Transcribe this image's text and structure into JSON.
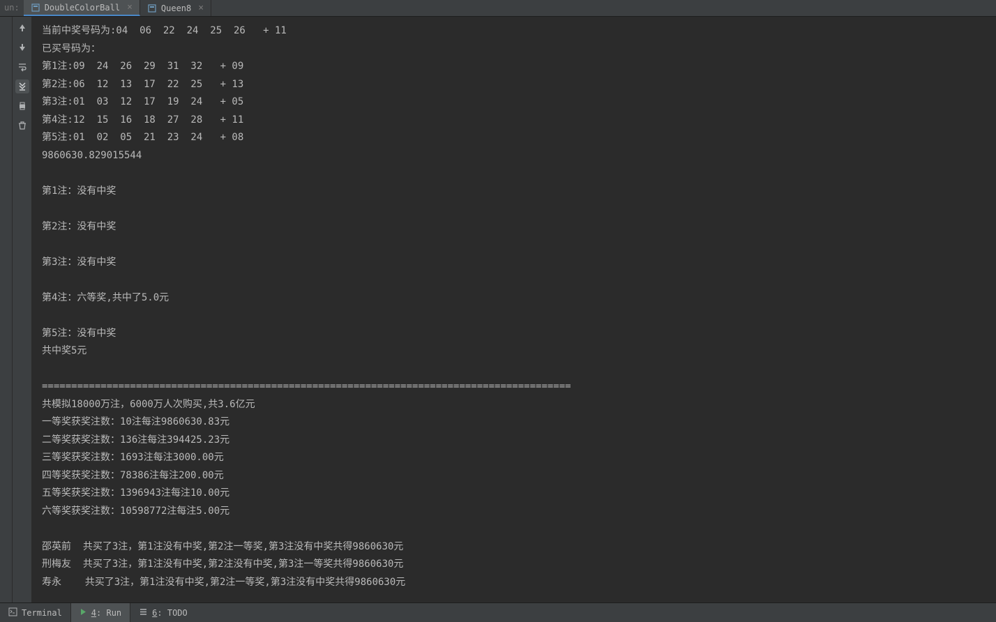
{
  "header": {
    "runLabel": "un:"
  },
  "tabs": [
    {
      "label": "DoubleColorBall",
      "active": true
    },
    {
      "label": "Queen8",
      "active": false
    }
  ],
  "console": {
    "lines": [
      "当前中奖号码为:04  06  22  24  25  26   + 11",
      "已买号码为：",
      "第1注:09  24  26  29  31  32   + 09",
      "第2注:06  12  13  17  22  25   + 13",
      "第3注:01  03  12  17  19  24   + 05",
      "第4注:12  15  16  18  27  28   + 11",
      "第5注:01  02  05  21  23  24   + 08",
      "9860630.829015544",
      "",
      "第1注：没有中奖",
      "",
      "第2注：没有中奖",
      "",
      "第3注：没有中奖",
      "",
      "第4注：六等奖,共中了5.0元",
      "",
      "第5注：没有中奖",
      "共中奖5元",
      "",
      "==========================================================================================",
      "共模拟18000万注，6000万人次购买,共3.6亿元",
      "一等奖获奖注数：10注每注9860630.83元",
      "二等奖获奖注数：136注每注394425.23元",
      "三等奖获奖注数：1693注每注3000.00元",
      "四等奖获奖注数：78386注每注200.00元",
      "五等奖获奖注数：1396943注每注10.00元",
      "六等奖获奖注数：10598772注每注5.00元",
      "",
      "邵英前  共买了3注，第1注没有中奖,第2注一等奖,第3注没有中奖共得9860630元",
      "刑梅友  共买了3注，第1注没有中奖,第2注没有中奖,第3注一等奖共得9860630元",
      "寿永    共买了3注，第1注没有中奖,第2注一等奖,第3注没有中奖共得9860630元"
    ]
  },
  "bottomBar": {
    "terminal": "Terminal",
    "run": "4: Run",
    "todo": "6: TODO"
  },
  "icons": {
    "fileIcon": "▭",
    "closeX": "×",
    "arrowUp": "↑",
    "arrowDown": "↓",
    "wrap": "⇥",
    "scroll": "⇊",
    "print": "🖶",
    "trash": "🗑",
    "play": "▶",
    "todoList": "☰"
  }
}
